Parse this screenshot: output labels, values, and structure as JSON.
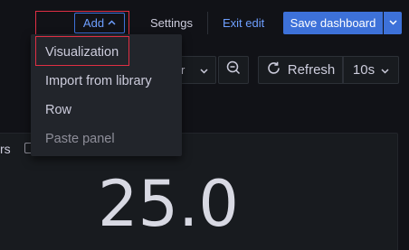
{
  "toolbar": {
    "add_label": "Add",
    "settings_label": "Settings",
    "exit_edit_label": "Exit edit",
    "save_dashboard_label": "Save dashboard"
  },
  "time_controls": {
    "time_picker_fragment": "r",
    "refresh_label": "Refresh",
    "interval_value": "10s"
  },
  "panel": {
    "title_fragment": "rs",
    "stat_value": "25.0"
  },
  "add_menu": {
    "items": [
      {
        "label": "Visualization"
      },
      {
        "label": "Import from library"
      },
      {
        "label": "Row"
      },
      {
        "label": "Paste panel"
      }
    ]
  },
  "colors": {
    "background": "#111217",
    "primary": "#3d71d9",
    "link": "#6e9fff",
    "highlight_box": "#e02f44",
    "menu_bg": "#22252b"
  }
}
